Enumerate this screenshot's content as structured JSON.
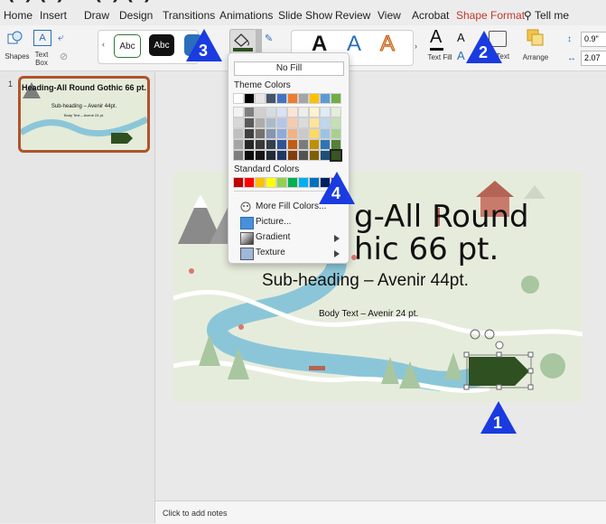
{
  "tabs": [
    {
      "label": "Home"
    },
    {
      "label": "Insert"
    },
    {
      "label": "Draw"
    },
    {
      "label": "Design"
    },
    {
      "label": "Transitions"
    },
    {
      "label": "Animations"
    },
    {
      "label": "Slide Show"
    },
    {
      "label": "Review"
    },
    {
      "label": "View"
    },
    {
      "label": "Acrobat"
    },
    {
      "label": "Shape Format"
    },
    {
      "label": "Tell me"
    }
  ],
  "ribbon": {
    "shapes_label": "Shapes",
    "textbox_label": "Text Box",
    "style_sample": "Abc",
    "big_a": "A",
    "text_fill_label": "Text Fill",
    "alt_text_label": "Alt Text",
    "arrange_label": "Arrange",
    "height_value": "0.9\"",
    "width_value": "2.07"
  },
  "fill_menu": {
    "no_fill": "No Fill",
    "theme_colors_label": "Theme Colors",
    "theme_top": [
      "#ffffff",
      "#000000",
      "#e7e6e6",
      "#44546a",
      "#4472c4",
      "#ed7d31",
      "#a5a5a5",
      "#ffc000",
      "#5b9bd5",
      "#70ad47"
    ],
    "theme_shades": [
      [
        "#f2f2f2",
        "#7f7f7f",
        "#d0cece",
        "#d6dce4",
        "#d9e2f3",
        "#fbe5d5",
        "#ededed",
        "#fff2cc",
        "#deebf6",
        "#e2efd9"
      ],
      [
        "#d8d8d8",
        "#595959",
        "#aeabab",
        "#adb9ca",
        "#b4c6e7",
        "#f7cbac",
        "#dbdbdb",
        "#fee599",
        "#bdd7ee",
        "#c5e0b3"
      ],
      [
        "#bfbfbf",
        "#3f3f3f",
        "#757070",
        "#8496b0",
        "#8eaadb",
        "#f4b183",
        "#c9c9c9",
        "#ffd965",
        "#9cc3e5",
        "#a8d08d"
      ],
      [
        "#a5a5a5",
        "#262626",
        "#3a3838",
        "#323f4f",
        "#2f5496",
        "#c55a11",
        "#7b7b7b",
        "#bf9000",
        "#2e75b5",
        "#538135"
      ],
      [
        "#7f7f7f",
        "#0c0c0c",
        "#171616",
        "#222a35",
        "#1f3864",
        "#833c0b",
        "#525252",
        "#7f6000",
        "#1e4e79",
        "#375623"
      ]
    ],
    "standard_colors_label": "Standard Colors",
    "standard_colors": [
      "#c00000",
      "#ff0000",
      "#ffc000",
      "#ffff00",
      "#92d050",
      "#00b050",
      "#00b0f0",
      "#0070c0",
      "#002060",
      "#7030a0"
    ],
    "more_fill": "More Fill Colors...",
    "picture": "Picture...",
    "gradient": "Gradient",
    "texture": "Texture"
  },
  "thumbnail": {
    "number": "1",
    "title": "Heading-All Round Gothic 66 pt.",
    "subtitle": "Sub-heading – Avenir 44pt.",
    "body": "Body Text – Avenir 24 pt."
  },
  "slide": {
    "heading_line1": "g-All Round",
    "heading_line2": "hic 66 pt.",
    "subheading": "Sub-heading – Avenir 44pt.",
    "body": "Body Text – Avenir 24 pt."
  },
  "notes_placeholder": "Click to add notes",
  "callouts": [
    "1",
    "2",
    "3",
    "4"
  ],
  "colors": {
    "accent": "#c0392b",
    "callout": "#1a3be0",
    "selected_fill": "#2f5020"
  }
}
